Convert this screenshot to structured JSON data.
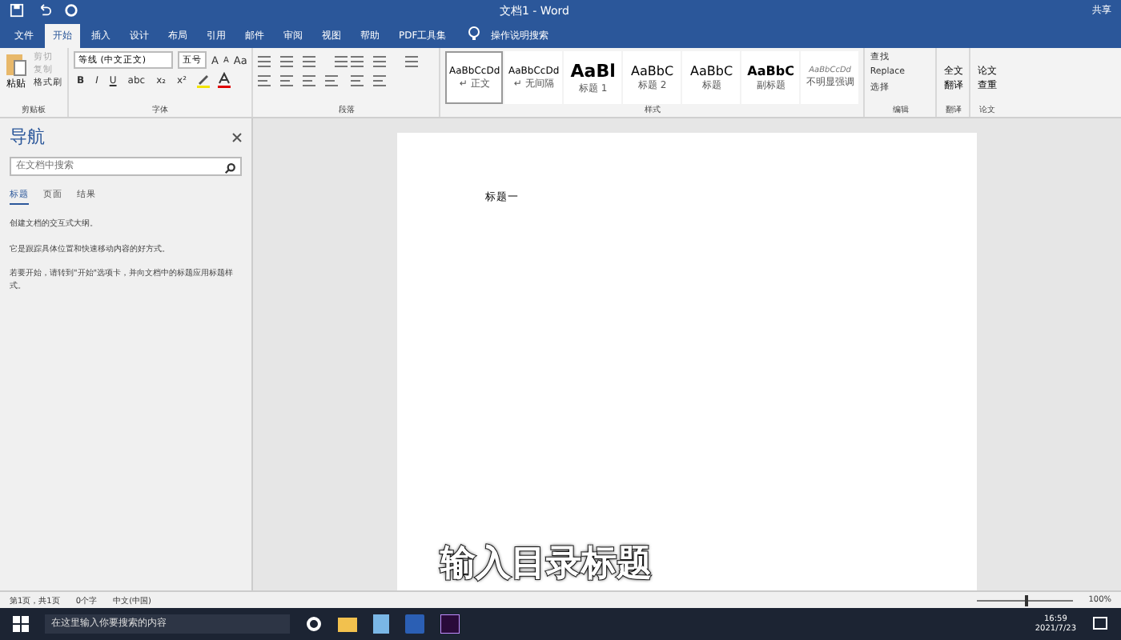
{
  "window": {
    "title": "文档1  -  Word",
    "share": "共享"
  },
  "tabs": [
    {
      "label": "文件",
      "selected": false
    },
    {
      "label": "开始",
      "selected": true
    },
    {
      "label": "插入",
      "selected": false
    },
    {
      "label": "设计",
      "selected": false
    },
    {
      "label": "布局",
      "selected": false
    },
    {
      "label": "引用",
      "selected": false
    },
    {
      "label": "邮件",
      "selected": false
    },
    {
      "label": "审阅",
      "selected": false
    },
    {
      "label": "视图",
      "selected": false
    },
    {
      "label": "帮助",
      "selected": false
    },
    {
      "label": "PDF工具集",
      "selected": false
    }
  ],
  "tell_me": "操作说明搜索",
  "clipboard": {
    "paste": "粘贴",
    "cut": "剪切",
    "copy": "复制",
    "format_painter": "格式刷",
    "label": "剪贴板"
  },
  "font": {
    "name": "等线 (中文正文)",
    "size": "五号",
    "grow": "A",
    "shrink": "A",
    "case": "Aa",
    "format_buttons": [
      "B",
      "I",
      "U",
      "abc",
      "x₂",
      "x²"
    ],
    "label": "字体"
  },
  "paragraph": {
    "label": "段落"
  },
  "styles": {
    "label": "样式",
    "items": [
      {
        "preview": "AaBbCcDd",
        "name": "↵ 正文",
        "kind": "body",
        "selected": true
      },
      {
        "preview": "AaBbCcDd",
        "name": "↵ 无间隔",
        "kind": "body",
        "selected": false
      },
      {
        "preview": "AaBl",
        "name": "标题 1",
        "kind": "heading1",
        "selected": false
      },
      {
        "preview": "AaBbC",
        "name": "标题 2",
        "kind": "heading2",
        "selected": false
      },
      {
        "preview": "AaBbC",
        "name": "标题",
        "kind": "heading2",
        "selected": false
      },
      {
        "preview": "AaBbC",
        "name": "副标题",
        "kind": "subtitle",
        "selected": false
      },
      {
        "preview": "AaBbCcDd",
        "name": "不明显强调",
        "kind": "emphasis",
        "selected": false
      }
    ]
  },
  "editing": {
    "find": "查找",
    "replace": "Replace",
    "select": "选择",
    "label": "编辑"
  },
  "translate": {
    "button": "全文翻译",
    "label": "翻译"
  },
  "paper": {
    "button": "论文查重",
    "label": "论文"
  },
  "navigation": {
    "title": "导航",
    "search_placeholder": "在文档中搜索",
    "tabs": [
      {
        "label": "标题",
        "selected": true
      },
      {
        "label": "页面",
        "selected": false
      },
      {
        "label": "结果",
        "selected": false
      }
    ],
    "paragraphs": [
      "创建文档的交互式大纲。",
      "它是跟踪具体位置和快速移动内容的好方式。",
      "若要开始，请转到\"开始\"选项卡，并向文档中的标题应用标题样式。"
    ]
  },
  "document": {
    "text": "标题一"
  },
  "subtitle": "输入目录标题",
  "status_bar": {
    "page": "第1页，共1页",
    "words": "0个字",
    "language": "中文(中国)",
    "zoom": "100%",
    "zoom_slider": {
      "level": 0.5
    }
  },
  "taskbar": {
    "search_placeholder": "在这里输入你要搜索的内容",
    "time": "16:59",
    "date": "2021/7/23"
  }
}
